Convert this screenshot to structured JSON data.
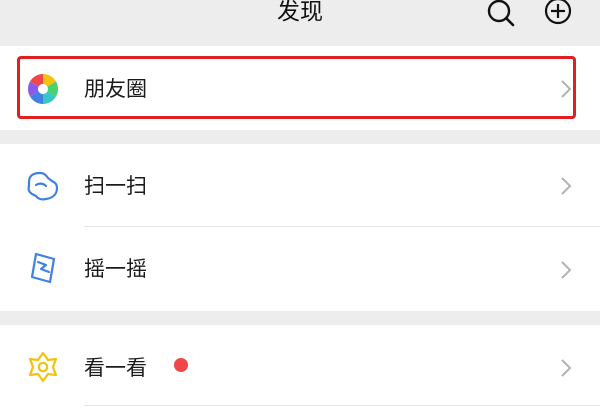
{
  "header": {
    "title": "发现",
    "search_icon": "search-icon",
    "add_icon": "add-icon"
  },
  "items": [
    {
      "label": "朋友圈",
      "icon": "moments-icon",
      "highlighted": true
    },
    {
      "label": "扫一扫",
      "icon": "scan-icon"
    },
    {
      "label": "摇一摇",
      "icon": "shake-icon"
    },
    {
      "label": "看一看",
      "icon": "top-stories-icon",
      "badge": "red-dot"
    }
  ],
  "colors": {
    "background": "#ededed",
    "card": "#ffffff",
    "highlight_border": "#e02020",
    "badge": "#f04848",
    "scan_shake_icon": "#3f82e4",
    "top_stories_icon": "#f4c20d"
  }
}
